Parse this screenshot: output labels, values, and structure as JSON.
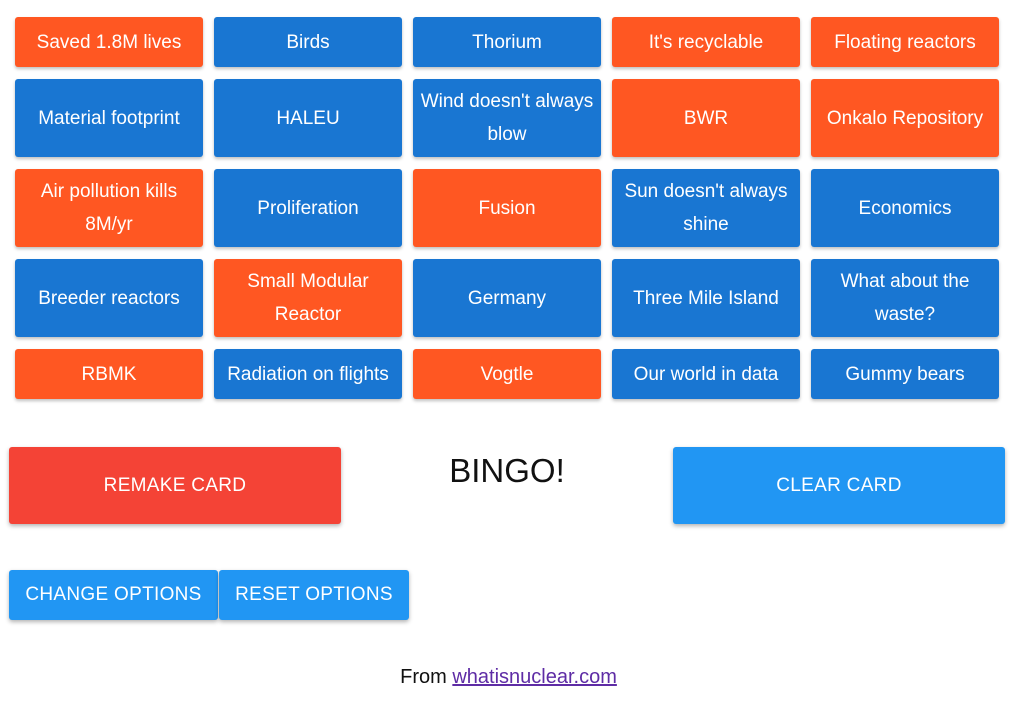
{
  "colors": {
    "blue_cell": "#1976d2",
    "orange_cell": "#ff5722",
    "remake_button": "#f44336",
    "primary_button": "#2196f3",
    "link": "#5e2ca5"
  },
  "card": {
    "cells": [
      {
        "label": "Saved 1.8M lives",
        "color": "orange"
      },
      {
        "label": "Birds",
        "color": "blue"
      },
      {
        "label": "Thorium",
        "color": "blue"
      },
      {
        "label": "It's recyclable",
        "color": "orange"
      },
      {
        "label": "Floating reactors",
        "color": "orange"
      },
      {
        "label": "Material footprint",
        "color": "blue"
      },
      {
        "label": "HALEU",
        "color": "blue"
      },
      {
        "label": "Wind doesn't always blow",
        "color": "blue"
      },
      {
        "label": "BWR",
        "color": "orange"
      },
      {
        "label": "Onkalo Repository",
        "color": "orange"
      },
      {
        "label": "Air pollution kills 8M/yr",
        "color": "orange"
      },
      {
        "label": "Proliferation",
        "color": "blue"
      },
      {
        "label": "Fusion",
        "color": "orange"
      },
      {
        "label": "Sun doesn't always shine",
        "color": "blue"
      },
      {
        "label": "Economics",
        "color": "blue"
      },
      {
        "label": "Breeder reactors",
        "color": "blue"
      },
      {
        "label": "Small Modular Reactor",
        "color": "orange"
      },
      {
        "label": "Germany",
        "color": "blue"
      },
      {
        "label": "Three Mile Island",
        "color": "blue"
      },
      {
        "label": "What about the waste?",
        "color": "blue"
      },
      {
        "label": "RBMK",
        "color": "orange"
      },
      {
        "label": "Radiation on flights",
        "color": "blue"
      },
      {
        "label": "Vogtle",
        "color": "orange"
      },
      {
        "label": "Our world in data",
        "color": "blue"
      },
      {
        "label": "Gummy bears",
        "color": "blue"
      }
    ]
  },
  "actions": {
    "remake_label": "REMAKE CARD",
    "bingo_text": "BINGO!",
    "clear_label": "CLEAR CARD",
    "change_options_label": "CHANGE OPTIONS",
    "reset_options_label": "RESET OPTIONS"
  },
  "footer": {
    "prefix": "From ",
    "link_text": "whatisnuclear.com"
  }
}
